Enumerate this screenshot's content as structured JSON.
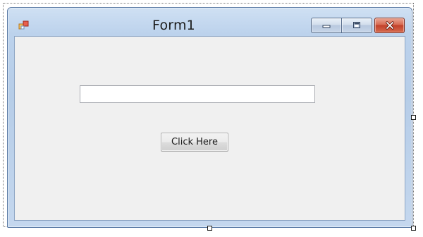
{
  "window": {
    "title": "Form1"
  },
  "form": {
    "textbox_value": "",
    "button_label": "Click Here"
  },
  "icons": {
    "app": "form-app-icon",
    "minimize": "minimize-icon",
    "maximize": "maximize-icon",
    "close": "close-icon"
  },
  "colors": {
    "titlebar": "#bcd2ec",
    "client_background": "#f0f0f0",
    "close_button": "#c2412a"
  }
}
